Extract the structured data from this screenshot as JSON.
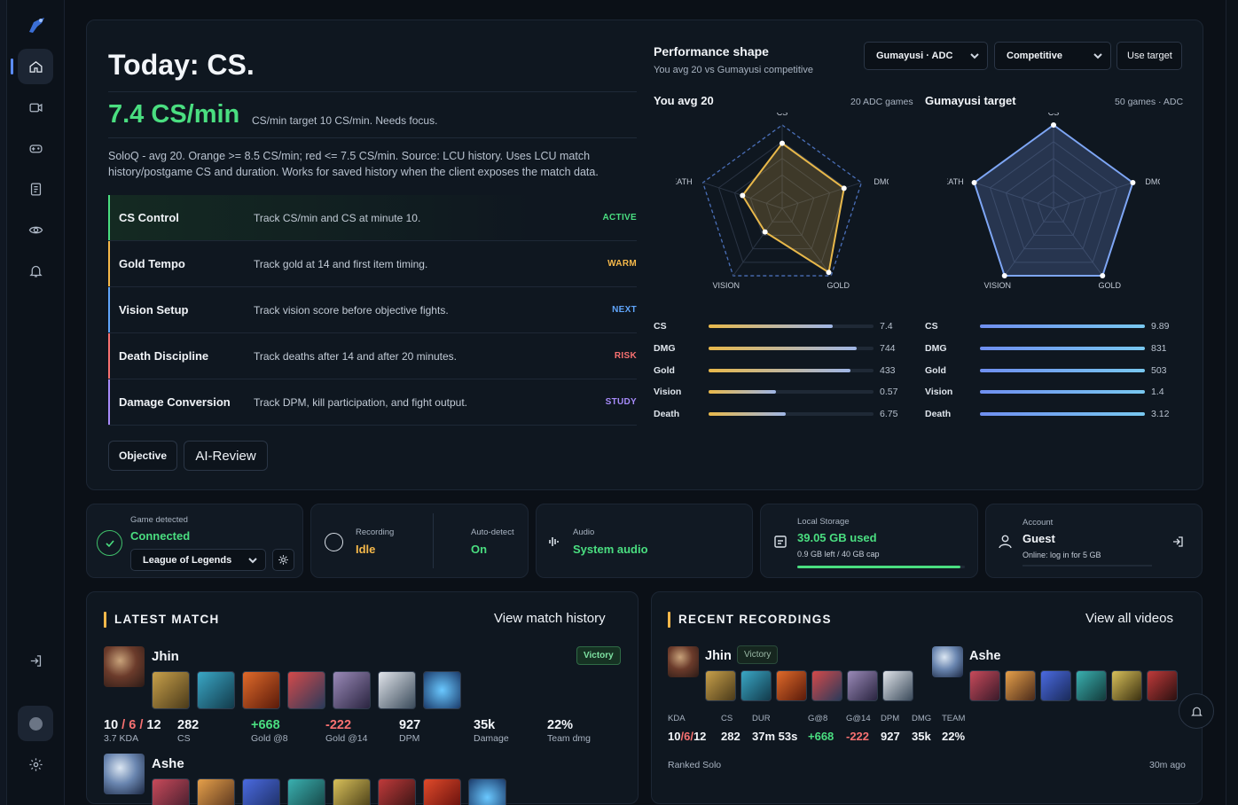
{
  "hero": {
    "title": "Today: CS.",
    "metric": "7.4 CS/min",
    "metric_note": "CS/min target 10 CS/min. Needs focus.",
    "description": "SoloQ - avg 20. Orange >= 8.5 CS/min; red <= 7.5 CS/min. Source: LCU history. Uses LCU match history/postgame CS and duration. Works for saved history when the client exposes the match data.",
    "focus": [
      {
        "name": "CS Control",
        "text": "Track CS/min and CS at minute 10.",
        "tag": "ACTIVE",
        "color": "#4ade80"
      },
      {
        "name": "Gold Tempo",
        "text": "Track gold at 14 and first item timing.",
        "tag": "WARM",
        "color": "#f5b84a"
      },
      {
        "name": "Vision Setup",
        "text": "Track vision score before objective fights.",
        "tag": "NEXT",
        "color": "#60a5fa"
      },
      {
        "name": "Death Discipline",
        "text": "Track deaths after 14 and after 20 minutes.",
        "tag": "RISK",
        "color": "#f87171"
      },
      {
        "name": "Damage Conversion",
        "text": "Track DPM, kill participation, and fight output.",
        "tag": "STUDY",
        "color": "#a78bfa"
      }
    ],
    "objective_btn": "Objective",
    "review_btn": "AI-Review"
  },
  "perf": {
    "title": "Performance shape",
    "subtitle": "You avg 20 vs Gumayusi competitive",
    "player_select": "Gumayusi · ADC",
    "mode_select": "Competitive",
    "use_target": "Use target",
    "left": {
      "title": "You avg 20",
      "meta": "20 ADC games",
      "axes": [
        "CS",
        "DMG",
        "GOLD",
        "VISION",
        "EATH"
      ],
      "shape": [
        0.78,
        0.78,
        0.95,
        0.35,
        0.5
      ],
      "stats": [
        {
          "label": "CS",
          "value": "7.4",
          "pct": 0.75
        },
        {
          "label": "DMG",
          "value": "744",
          "pct": 0.9
        },
        {
          "label": "Gold",
          "value": "433",
          "pct": 0.86
        },
        {
          "label": "Vision",
          "value": "0.57",
          "pct": 0.41
        },
        {
          "label": "Death",
          "value": "6.75",
          "pct": 0.47
        }
      ],
      "color": "#e8b84a"
    },
    "right": {
      "title": "Gumayusi target",
      "meta": "50 games · ADC",
      "axes": [
        "CS",
        "DMG",
        "GOLD",
        "VISION",
        "EATH"
      ],
      "shape": [
        1,
        1,
        1,
        1,
        1
      ],
      "stats": [
        {
          "label": "CS",
          "value": "9.89",
          "pct": 1
        },
        {
          "label": "DMG",
          "value": "831",
          "pct": 1
        },
        {
          "label": "Gold",
          "value": "503",
          "pct": 1
        },
        {
          "label": "Vision",
          "value": "1.4",
          "pct": 1
        },
        {
          "label": "Death",
          "value": "3.12",
          "pct": 1
        }
      ],
      "color": "#7ea6f5"
    }
  },
  "status": {
    "game_label": "Game detected",
    "game_value": "Connected",
    "game_select": "League of Legends",
    "recording_label": "Recording",
    "recording_value": "Idle",
    "autodetect_label": "Auto-detect",
    "autodetect_value": "On",
    "audio_label": "Audio",
    "audio_value": "System audio",
    "storage_label": "Local Storage",
    "storage_value": "39.05 GB used",
    "storage_sub": "0.9 GB left / 40 GB cap",
    "storage_pct": 0.976,
    "account_label": "Account",
    "account_value": "Guest",
    "account_sub": "Online: log in for 5 GB"
  },
  "latest": {
    "title": "LATEST MATCH",
    "link": "View match history",
    "champ": "Jhin",
    "result": "Victory",
    "kda_k": "10",
    "kda_d": "6",
    "kda_a": "12",
    "kda_sub": "3.7 KDA",
    "cs": "282",
    "cs_sub": "CS",
    "gold8": "+668",
    "gold8_sub": "Gold @8",
    "gold14": "-222",
    "gold14_sub": "Gold @14",
    "dpm": "927",
    "dpm_sub": "DPM",
    "dmg": "35k",
    "dmg_sub": "Damage",
    "team": "22%",
    "team_sub": "Team dmg",
    "champ2": "Ashe"
  },
  "recent": {
    "title": "RECENT RECORDINGS",
    "link": "View all videos",
    "champ1": "Jhin",
    "badge1": "Victory",
    "champ2": "Ashe",
    "headers": [
      "KDA",
      "CS",
      "DUR",
      "G@8",
      "G@14",
      "DPM",
      "DMG",
      "TEAM"
    ],
    "kda_k": "10",
    "kda_d": "6",
    "kda_a": "12",
    "cs": "282",
    "dur": "37m 53s",
    "g8": "+668",
    "g14": "-222",
    "dpm": "927",
    "dmg": "35k",
    "team": "22%",
    "queue": "Ranked Solo",
    "ago": "30m ago"
  }
}
